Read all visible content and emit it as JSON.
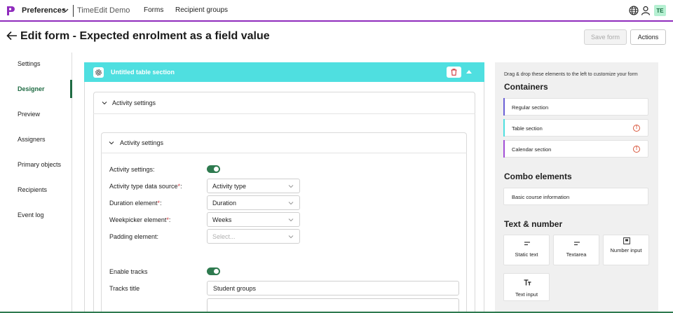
{
  "topbar": {
    "app_name": "Preferences",
    "org_name": "TimeEdit Demo",
    "nav": [
      "Forms",
      "Recipient groups"
    ],
    "avatar_initials": "TE",
    "accent_color": "#8f2bbd"
  },
  "header": {
    "title": "Edit form - Expected enrolment as a field value",
    "save_label": "Save form",
    "actions_label": "Actions"
  },
  "sidebar": {
    "items": [
      {
        "label": "Settings",
        "active": false
      },
      {
        "label": "Designer",
        "active": true
      },
      {
        "label": "Preview",
        "active": false
      },
      {
        "label": "Assigners",
        "active": false
      },
      {
        "label": "Primary objects",
        "active": false
      },
      {
        "label": "Recipients",
        "active": false
      },
      {
        "label": "Event log",
        "active": false
      }
    ]
  },
  "canvas": {
    "section_title": "Untitled table section",
    "section_color": "#4fdfe0",
    "outer_group_label": "Activity settings",
    "inner_group_label": "Activity settings",
    "fields": {
      "activity_settings": {
        "label": "Activity settings:",
        "enabled": true
      },
      "activity_type": {
        "label": "Activity type data source",
        "required": "*",
        "suffix": ":",
        "value": "Activity type"
      },
      "duration": {
        "label": "Duration element",
        "required": "*",
        "suffix": ":",
        "value": "Duration"
      },
      "weekpicker": {
        "label": "Weekpicker element",
        "required": "*",
        "suffix": ":",
        "value": "Weeks"
      },
      "padding": {
        "label": "Padding element:",
        "placeholder": "Select..."
      },
      "enable_tracks": {
        "label": "Enable tracks",
        "enabled": true
      },
      "tracks_title": {
        "label": "Tracks title",
        "value": "Student groups"
      }
    }
  },
  "palette": {
    "hint": "Drag & drop these elements to the left to customize your form",
    "containers_heading": "Containers",
    "containers": [
      {
        "label": "Regular section",
        "accent": "#6b5fd6",
        "warning": false
      },
      {
        "label": "Table section",
        "accent": "#4fdfe0",
        "warning": true
      },
      {
        "label": "Calendar section",
        "accent": "#a24fd6",
        "warning": true
      }
    ],
    "combo_heading": "Combo elements",
    "combo": [
      {
        "label": "Basic course information"
      }
    ],
    "text_heading": "Text & number",
    "tiles": [
      {
        "label": "Static text",
        "icon": "text-lines-icon"
      },
      {
        "label": "Textarea",
        "icon": "text-lines-icon"
      },
      {
        "label": "Number input",
        "icon": "number-input-icon"
      },
      {
        "label": "Text input",
        "icon": "text-format-icon"
      }
    ],
    "warning_glyph": "!"
  }
}
